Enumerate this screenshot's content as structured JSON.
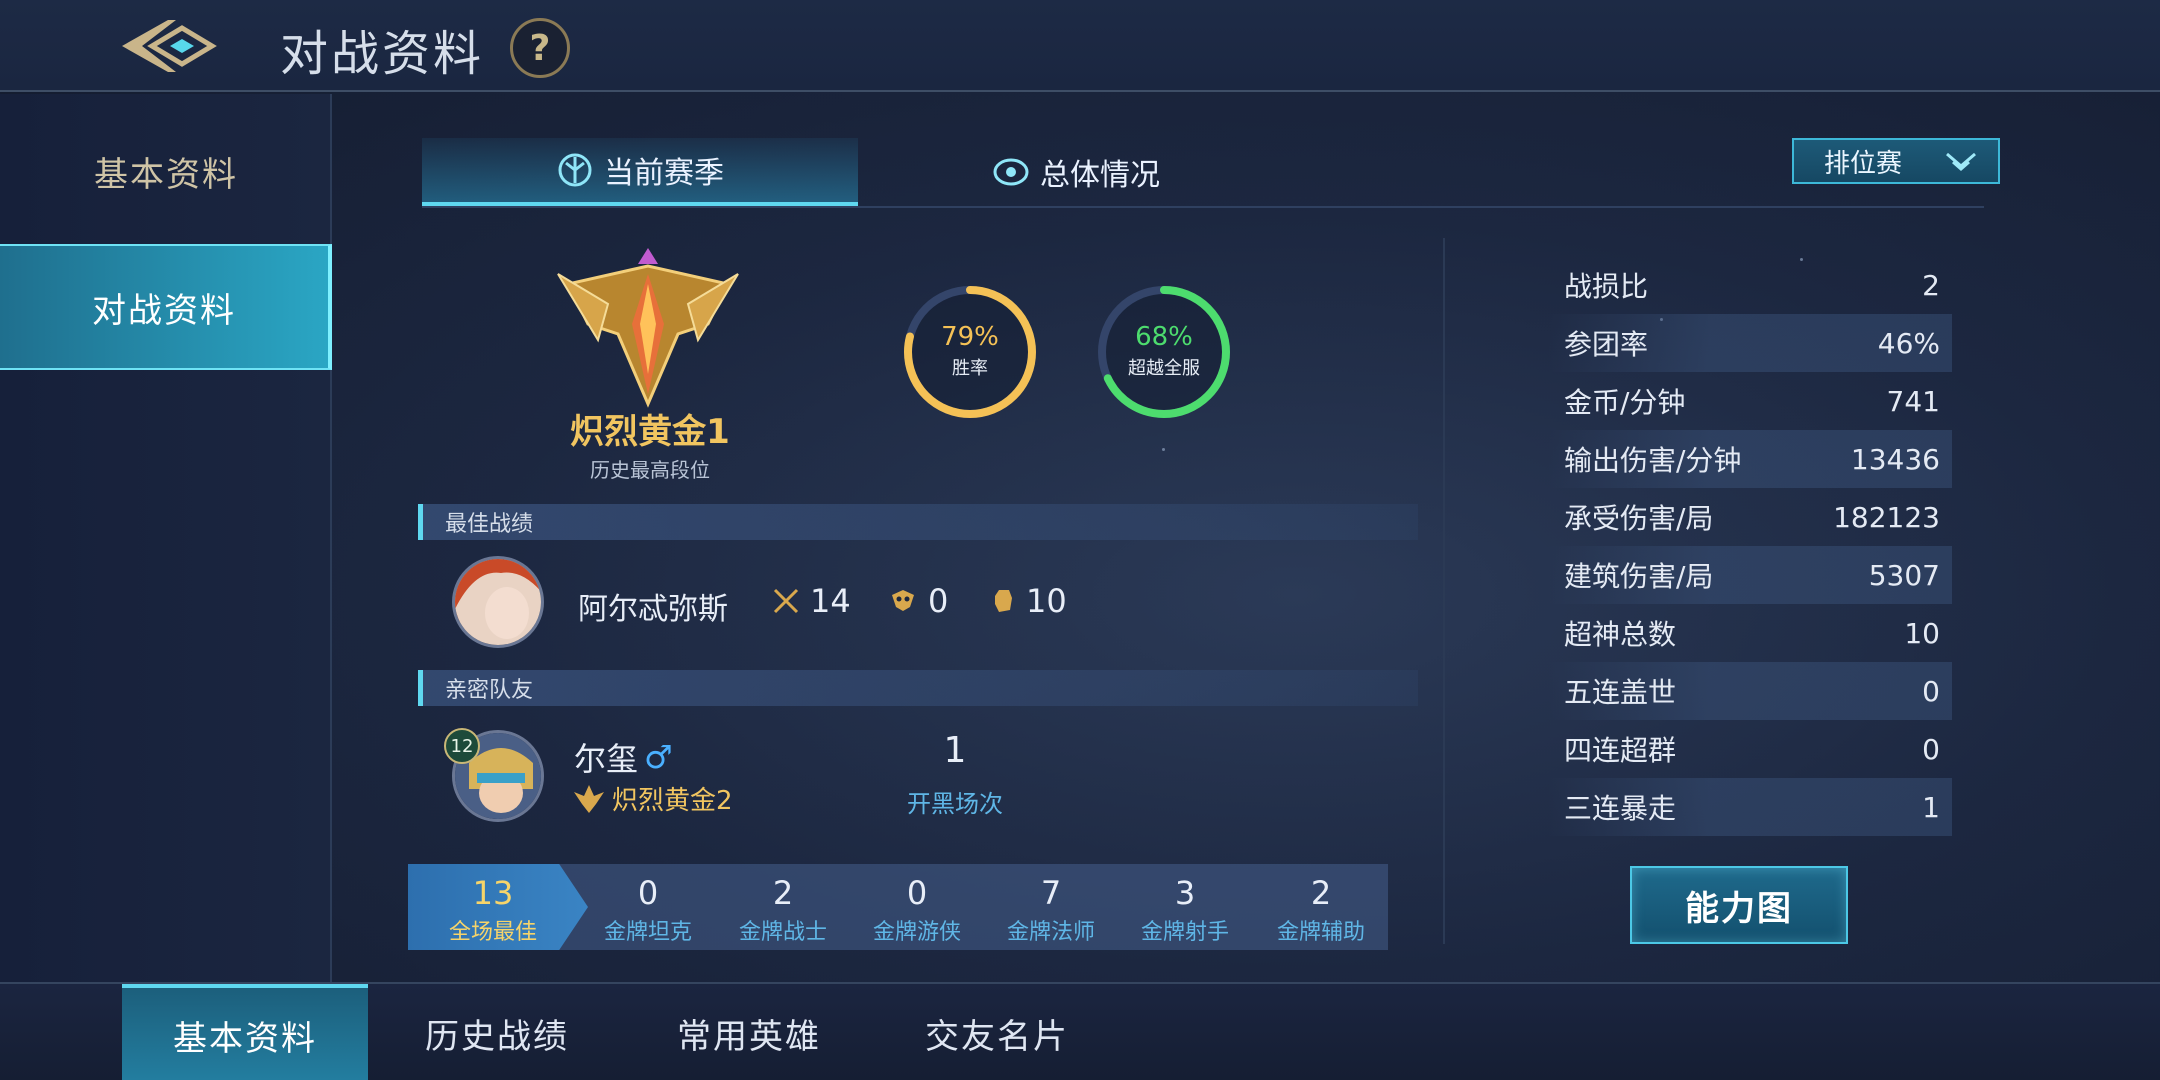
{
  "header": {
    "title": "对战资料",
    "help_label": "?"
  },
  "sidebar": {
    "items": [
      {
        "label": "基本资料",
        "active": false
      },
      {
        "label": "对战资料",
        "active": true
      }
    ]
  },
  "tabs": [
    {
      "label": "当前赛季",
      "active": true
    },
    {
      "label": "总体情况",
      "active": false
    }
  ],
  "mode_select": {
    "value": "排位赛"
  },
  "rank": {
    "name": "炽烈黄金1",
    "caption": "历史最高段位"
  },
  "rings": {
    "winrate": {
      "value": "79%",
      "label": "胜率",
      "fraction": 0.79,
      "color": "#f4c156"
    },
    "surpass": {
      "value": "68%",
      "label": "超越全服",
      "fraction": 0.68,
      "color": "#4ddc6e"
    }
  },
  "best_record": {
    "section_title": "最佳战绩",
    "hero_name": "阿尔忒弥斯",
    "kills": "14",
    "deaths": "0",
    "assists": "10"
  },
  "close_teammate": {
    "section_title": "亲密队友",
    "level": "12",
    "name": "尔玺",
    "gender_symbol": "♂",
    "rank": "炽烈黄金2",
    "games_together": "1",
    "games_label": "开黑场次"
  },
  "medals": [
    {
      "count": "13",
      "label": "全场最佳"
    },
    {
      "count": "0",
      "label": "金牌坦克"
    },
    {
      "count": "2",
      "label": "金牌战士"
    },
    {
      "count": "0",
      "label": "金牌游侠"
    },
    {
      "count": "7",
      "label": "金牌法师"
    },
    {
      "count": "3",
      "label": "金牌射手"
    },
    {
      "count": "2",
      "label": "金牌辅助"
    }
  ],
  "stats": [
    {
      "label": "战损比",
      "value": "2"
    },
    {
      "label": "参团率",
      "value": "46%"
    },
    {
      "label": "金币/分钟",
      "value": "741"
    },
    {
      "label": "输出伤害/分钟",
      "value": "13436"
    },
    {
      "label": "承受伤害/局",
      "value": "182123"
    },
    {
      "label": "建筑伤害/局",
      "value": "5307"
    },
    {
      "label": "超神总数",
      "value": "10"
    },
    {
      "label": "五连盖世",
      "value": "0"
    },
    {
      "label": "四连超群",
      "value": "0"
    },
    {
      "label": "三连暴走",
      "value": "1"
    }
  ],
  "ability_button": {
    "label": "能力图"
  },
  "bottom_tabs": [
    {
      "label": "基本资料",
      "active": true
    },
    {
      "label": "历史战绩",
      "active": false
    },
    {
      "label": "常用英雄",
      "active": false
    },
    {
      "label": "交友名片",
      "active": false
    }
  ]
}
